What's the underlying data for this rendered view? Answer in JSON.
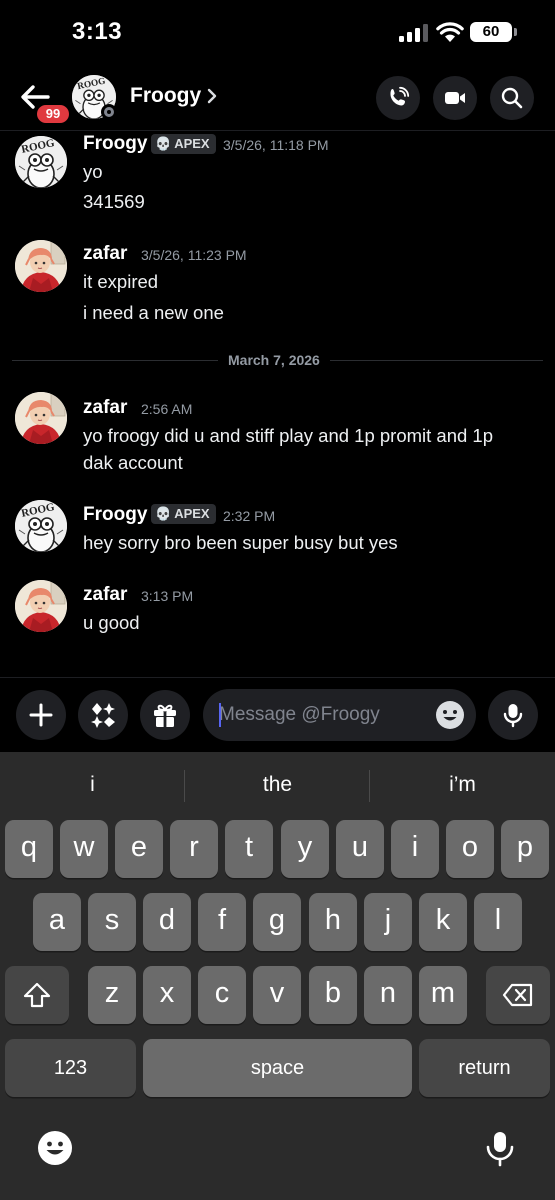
{
  "status_bar": {
    "time": "3:13",
    "battery": "60"
  },
  "header": {
    "back_badge": "99",
    "name": "Froogy",
    "icons": [
      "phone-call-icon",
      "video-camera-icon",
      "search-icon"
    ]
  },
  "messages": [
    {
      "author": "Froogy",
      "tag": "APEX",
      "time": "3/5/26, 11:18 PM",
      "lines": [
        "yo",
        "341569"
      ]
    },
    {
      "author": "zafar",
      "time": "3/5/26, 11:23 PM",
      "lines": [
        "it expired",
        "i need a new one"
      ]
    },
    {
      "author": "zafar",
      "time": "2:56 AM",
      "lines": [
        "yo froogy did u and stiff play and 1p promit and 1p",
        "dak account"
      ]
    },
    {
      "author": "Froogy",
      "tag": "APEX",
      "time": "2:32 PM",
      "lines": [
        "hey sorry bro been super busy but yes"
      ]
    },
    {
      "author": "zafar",
      "time": "3:13 PM",
      "lines": [
        "u good"
      ]
    }
  ],
  "date_separator": "March 7, 2026",
  "composer": {
    "placeholder": "Message @Froogy"
  },
  "keyboard": {
    "suggestions": [
      "i",
      "the",
      "i’m"
    ],
    "row1": [
      "q",
      "w",
      "e",
      "r",
      "t",
      "y",
      "u",
      "i",
      "o",
      "p"
    ],
    "row2": [
      "a",
      "s",
      "d",
      "f",
      "g",
      "h",
      "j",
      "k",
      "l"
    ],
    "row3": [
      "z",
      "x",
      "c",
      "v",
      "b",
      "n",
      "m"
    ],
    "numbers_key": "123",
    "space_key": "space",
    "return_key": "return"
  },
  "colors": {
    "background": "#000000",
    "badge": "#e0393f",
    "keyboard": "#2b2b2b",
    "key": "#6b6b6b"
  }
}
